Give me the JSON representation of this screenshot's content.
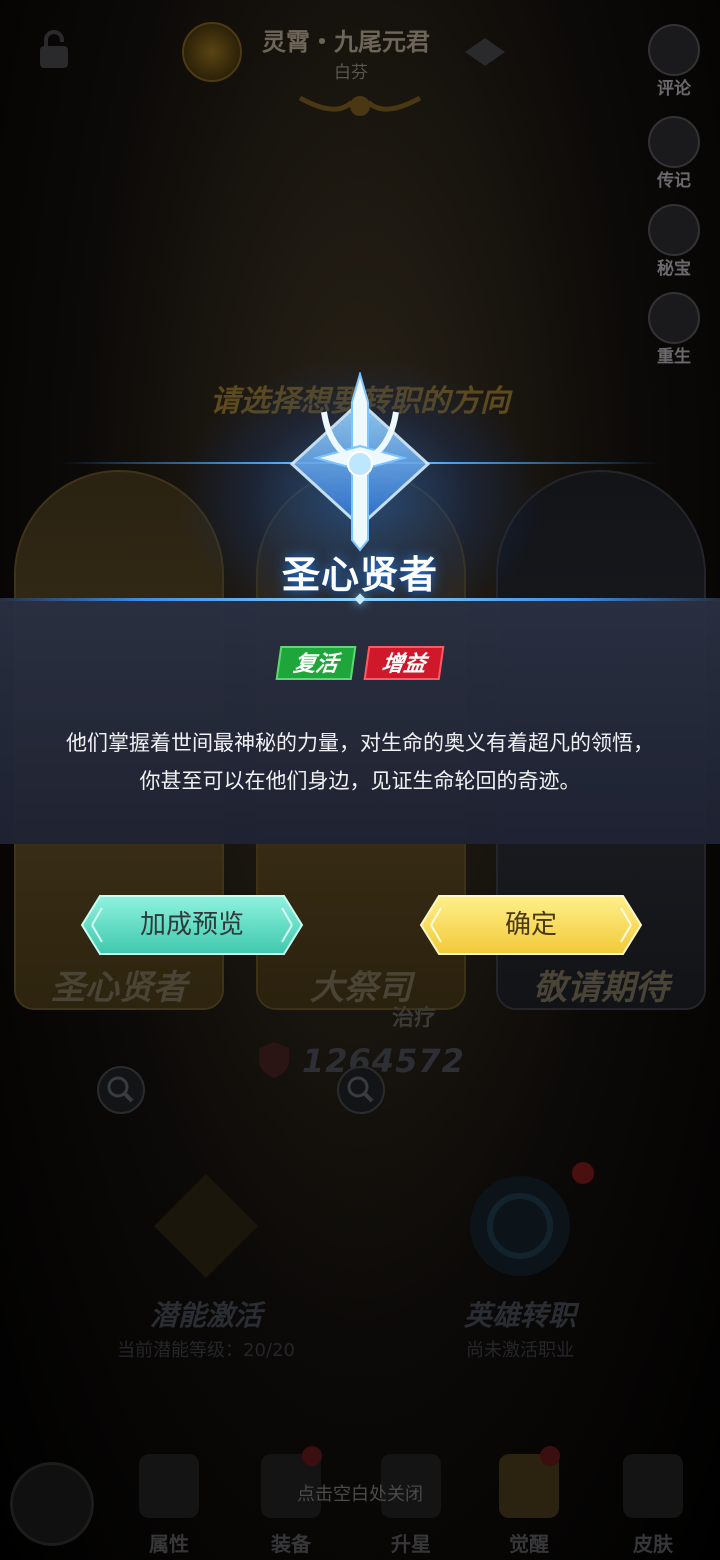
{
  "header": {
    "hero_title": "灵霄・九尾元君",
    "hero_subtitle": "白芬"
  },
  "side_menu": [
    {
      "label": "评论",
      "icon": "comment-icon"
    },
    {
      "label": "传记",
      "icon": "book-icon"
    },
    {
      "label": "秘宝",
      "icon": "treasure-icon"
    },
    {
      "label": "重生",
      "icon": "rebirth-icon"
    }
  ],
  "background": {
    "prompt": "请选择想要转职的方向",
    "cards": [
      {
        "name": "圣心贤者"
      },
      {
        "name": "大祭司"
      },
      {
        "name": "敬请期待"
      }
    ],
    "extra_label": "治疗",
    "power_value": "1264572",
    "features": [
      {
        "title": "潜能激活",
        "subtitle": "当前潜能等级：20/20"
      },
      {
        "title": "英雄转职",
        "subtitle": "尚未激活职业"
      }
    ],
    "close_hint": "点击空白处关闭",
    "bottom_nav": [
      {
        "label": "属性"
      },
      {
        "label": "装备"
      },
      {
        "label": "升星"
      },
      {
        "label": "觉醒"
      },
      {
        "label": "皮肤"
      }
    ]
  },
  "popup": {
    "class_name": "圣心贤者",
    "tags": [
      {
        "label": "复活",
        "color": "#1fa63a"
      },
      {
        "label": "增益",
        "color": "#d0182b"
      }
    ],
    "description_line1": "他们掌握着世间最神秘的力量，对生命的奥义有着超凡的领悟，",
    "description_line2": "你甚至可以在他们身边，见证生命轮回的奇迹。",
    "buttons": {
      "preview_label": "加成预览",
      "confirm_label": "确定"
    }
  },
  "colors": {
    "accent_blue": "#3c8fea",
    "preview_button": "#5fe0c6",
    "confirm_button": "#f7dc5a",
    "tag_green": "#1fa63a",
    "tag_red": "#d0182b"
  }
}
